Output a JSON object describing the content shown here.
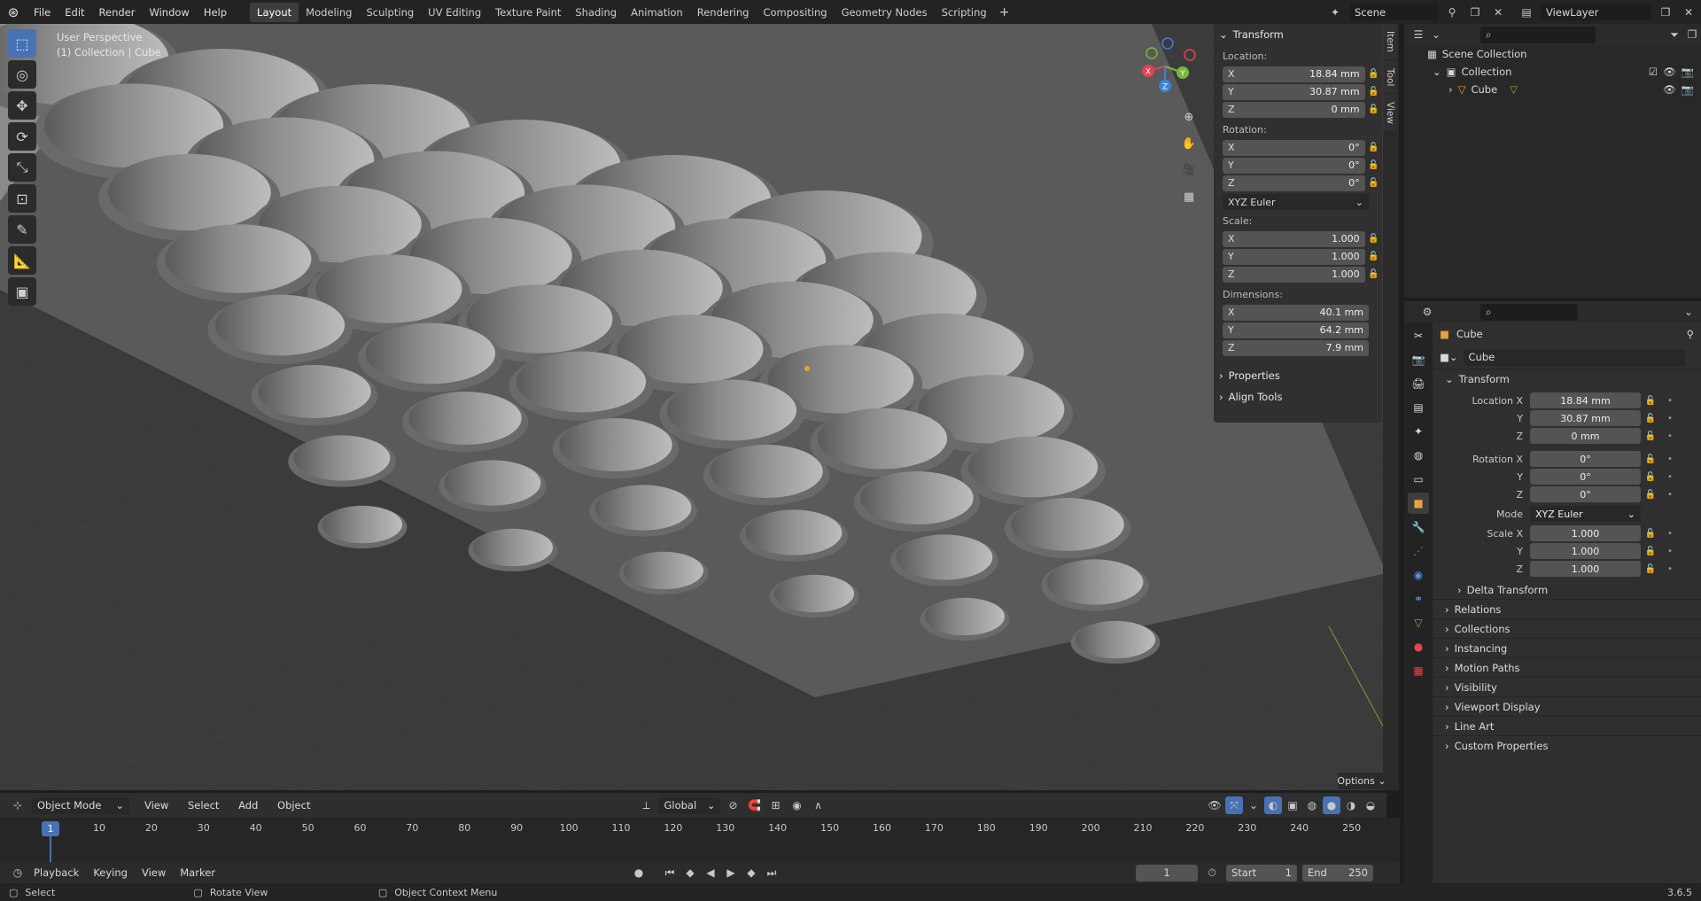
{
  "topbar": {
    "menu": [
      "File",
      "Edit",
      "Render",
      "Window",
      "Help"
    ],
    "workspaces": [
      "Layout",
      "Modeling",
      "Sculpting",
      "UV Editing",
      "Texture Paint",
      "Shading",
      "Animation",
      "Rendering",
      "Compositing",
      "Geometry Nodes",
      "Scripting"
    ],
    "active_workspace": "Layout",
    "scene": "Scene",
    "view_layer": "ViewLayer"
  },
  "viewport": {
    "perspective": "User Perspective",
    "collection_info": "(1) Collection | Cube",
    "origin_color": "#e8a23a",
    "options": "Options"
  },
  "gizmo": {
    "x": "X",
    "y": "Y",
    "z": "Z"
  },
  "npanel": {
    "transform_title": "Transform",
    "location_label": "Location:",
    "location": [
      {
        "axis": "X",
        "value": "18.84 mm"
      },
      {
        "axis": "Y",
        "value": "30.87 mm"
      },
      {
        "axis": "Z",
        "value": "0 mm"
      }
    ],
    "rotation_label": "Rotation:",
    "rotation": [
      {
        "axis": "X",
        "value": "0°"
      },
      {
        "axis": "Y",
        "value": "0°"
      },
      {
        "axis": "Z",
        "value": "0°"
      }
    ],
    "rotation_mode": "XYZ Euler",
    "scale_label": "Scale:",
    "scale": [
      {
        "axis": "X",
        "value": "1.000"
      },
      {
        "axis": "Y",
        "value": "1.000"
      },
      {
        "axis": "Z",
        "value": "1.000"
      }
    ],
    "dimensions_label": "Dimensions:",
    "dimensions": [
      {
        "axis": "X",
        "value": "40.1 mm"
      },
      {
        "axis": "Y",
        "value": "64.2 mm"
      },
      {
        "axis": "Z",
        "value": "7.9 mm"
      }
    ],
    "properties": "Properties",
    "align_tools": "Align Tools",
    "tabs": [
      "Item",
      "Tool",
      "View"
    ]
  },
  "vp_header": {
    "mode": "Object Mode",
    "menus": [
      "View",
      "Select",
      "Add",
      "Object"
    ],
    "orientation": "Global"
  },
  "timeline": {
    "current_frame_marker": "1",
    "ticks": [
      "10",
      "20",
      "30",
      "40",
      "50",
      "60",
      "70",
      "80",
      "90",
      "100",
      "110",
      "120",
      "130",
      "140",
      "150",
      "160",
      "170",
      "180",
      "190",
      "200",
      "210",
      "220",
      "230",
      "240",
      "250"
    ],
    "menus": [
      "Playback",
      "Keying",
      "View",
      "Marker"
    ],
    "frame": "1",
    "start_label": "Start",
    "start": "1",
    "end_label": "End",
    "end": "250"
  },
  "status": {
    "select": "Select",
    "rotate": "Rotate View",
    "context": "Object Context Menu",
    "version": "3.6.5"
  },
  "outliner": {
    "scene_collection": "Scene Collection",
    "collection": "Collection",
    "cube": "Cube"
  },
  "props": {
    "object_name": "Cube",
    "data_name": "Cube",
    "transform": "Transform",
    "location_x_label": "Location X",
    "y_label": "Y",
    "z_label": "Z",
    "location": [
      "18.84 mm",
      "30.87 mm",
      "0 mm"
    ],
    "rotation_x_label": "Rotation X",
    "rotation": [
      "0°",
      "0°",
      "0°"
    ],
    "mode_label": "Mode",
    "mode": "XYZ Euler",
    "scale_x_label": "Scale X",
    "scale": [
      "1.000",
      "1.000",
      "1.000"
    ],
    "delta": "Delta Transform",
    "sections": [
      "Relations",
      "Collections",
      "Instancing",
      "Motion Paths",
      "Visibility",
      "Viewport Display",
      "Line Art",
      "Custom Properties"
    ]
  },
  "colors": {
    "accent": "#4772b3",
    "x_axis": "#e0444e",
    "y_axis": "#7cb63b",
    "z_axis": "#3d82d8"
  }
}
